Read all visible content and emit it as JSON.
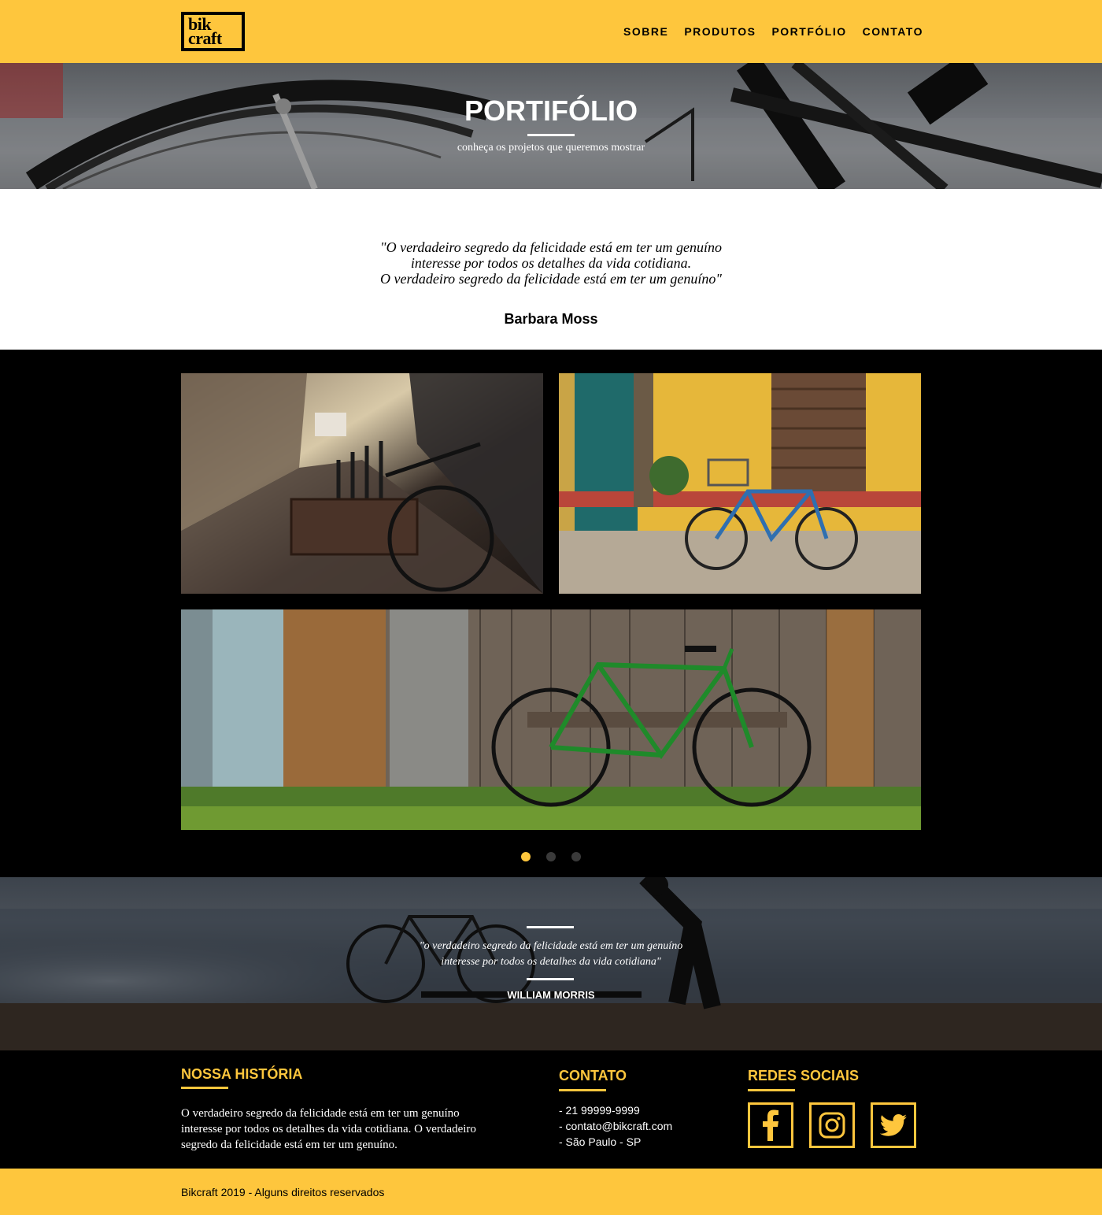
{
  "header": {
    "logo_line1": "bik",
    "logo_line2": "craft",
    "nav": [
      "SOBRE",
      "PRODUTOS",
      "PORTFÓLIO",
      "CONTATO"
    ]
  },
  "hero": {
    "title": "PORTIFÓLIO",
    "subtitle": "conheça os projetos que queremos mostrar"
  },
  "quote": {
    "line1": "\"O verdadeiro segredo da felicidade está em ter um genuíno",
    "line2": "interesse por todos os detalhes da vida cotidiana.",
    "line3": "O verdadeiro segredo da felicidade está em ter um genuíno\"",
    "author": "Barbara Moss"
  },
  "gallery": {
    "images": [
      "street-bicycle-photo",
      "yellow-wall-bicycle-photo",
      "green-bicycle-wooden-wall-photo"
    ],
    "slides": 3,
    "active_slide": 1
  },
  "quote2": {
    "line1": "\"o verdadeiro segredo da felicidade está em ter um genuíno",
    "line2": "interesse por todos os detalhes da vida cotidiana\"",
    "author": "WILLIAM MORRIS"
  },
  "footer": {
    "history_title": "NOSSA HISTÓRIA",
    "history_text": "O verdadeiro segredo da felicidade está em ter um genuíno interesse por todos os detalhes da vida cotidiana. O verdadeiro segredo da felicidade está em ter um genuíno.",
    "contact_title": "CONTATO",
    "contact": [
      "- 21 99999-9999",
      "- contato@bikcraft.com",
      "- São Paulo - SP"
    ],
    "social_title": "REDES SOCIAIS",
    "social_icons": [
      "facebook-icon",
      "instagram-icon",
      "twitter-icon"
    ],
    "copyright": "Bikcraft 2019 - Alguns direitos reservados"
  },
  "colors": {
    "accent": "#FEC63D",
    "dark": "#000000",
    "light": "#FFFFFF"
  }
}
